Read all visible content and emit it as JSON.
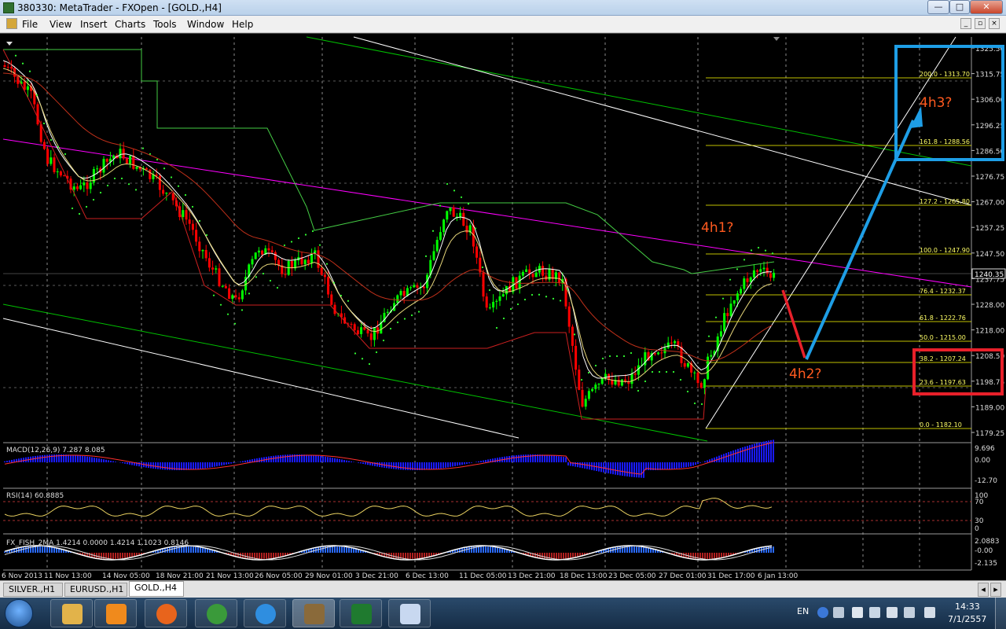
{
  "window": {
    "title": "380330: MetaTrader - FXOpen - [GOLD.,H4]",
    "buttons": {
      "minimize": "—",
      "maximize": "□",
      "close": "✕"
    }
  },
  "menu": {
    "items": [
      "File",
      "View",
      "Insert",
      "Charts",
      "Tools",
      "Window",
      "Help"
    ],
    "mdi_buttons": [
      "_",
      "▫",
      "×"
    ]
  },
  "chart": {
    "symbol": "GOLD.,H4",
    "colors": {
      "background": "#000000",
      "bull_candle": "#00ff00",
      "bear_candle": "#ff0000",
      "fib": "#ffff00",
      "channel_green": "#00c000",
      "channel_white": "#ffffff",
      "trendline": "#ff00ff",
      "annotation_orange": "#ff5a1f",
      "annotation_blue": "#1e9ee6",
      "annotation_red": "#e8202a"
    },
    "price_axis": [
      "1325.50",
      "1315.75",
      "1306.00",
      "1296.25",
      "1286.50",
      "1276.75",
      "1267.00",
      "1257.25",
      "1247.50",
      "1237.75",
      "1228.00",
      "1218.00",
      "1208.50",
      "1198.75",
      "1189.00",
      "1179.25"
    ],
    "current_price": "1240.35",
    "time_axis": [
      "6 Nov 2013",
      "11 Nov 13:00",
      "14 Nov 05:00",
      "18 Nov 21:00",
      "21 Nov 13:00",
      "26 Nov 05:00",
      "29 Nov 01:00",
      "3 Dec 21:00",
      "6 Dec 13:00",
      "11 Dec 05:00",
      "13 Dec 21:00",
      "18 Dec 13:00",
      "23 Dec 05:00",
      "27 Dec 01:00",
      "31 Dec 17:00",
      "6 Jan 13:00"
    ],
    "fib_levels": [
      "200.0 - 1313.70",
      "161.8 - 1288.56",
      "127.2 - 1265.80",
      "100.0 - 1247.90",
      "76.4 - 1232.37",
      "61.8 - 1222.76",
      "50.0 - 1215.00",
      "38.2 - 1207.24",
      "23.6 - 1197.63",
      "0.0 - 1182.10"
    ],
    "annotations": {
      "wave1": "4h1?",
      "wave2": "4h2?",
      "wave3": "4h3?"
    },
    "macd": {
      "label": "MACD(12,26,9) 7.287 8.085",
      "axis": [
        "9.696",
        "0.00",
        "-12.70"
      ]
    },
    "rsi": {
      "label": "RSI(14) 60.8885",
      "axis": [
        "100",
        "70",
        "30",
        "0"
      ]
    },
    "fisher": {
      "label": "FX_FISH_2MA 1.4214 0.0000 1.4214 1.1023 0.8146",
      "axis": [
        "2.0883",
        "-0.00",
        "-2.135"
      ]
    }
  },
  "tabs": [
    {
      "label": "SILVER.,H1",
      "active": false
    },
    {
      "label": "EURUSD.,H1",
      "active": false
    },
    {
      "label": "GOLD.,H4",
      "active": true
    }
  ],
  "taskbar": {
    "apps": [
      {
        "name": "file-explorer-icon",
        "color": "#e2b34a"
      },
      {
        "name": "media-player-icon",
        "color": "#f08a1c"
      },
      {
        "name": "firefox-icon",
        "color": "#e8641c"
      },
      {
        "name": "chrome-icon",
        "color": "#3a9a3a"
      },
      {
        "name": "internet-explorer-icon",
        "color": "#2f8ee0"
      },
      {
        "name": "metatrader-icon",
        "color": "#8a6a3a"
      },
      {
        "name": "excel-icon",
        "color": "#1f7a2f"
      },
      {
        "name": "paint-icon",
        "color": "#c8d8f0"
      }
    ],
    "language": "EN",
    "time": "14:33",
    "date": "7/1/2557"
  }
}
